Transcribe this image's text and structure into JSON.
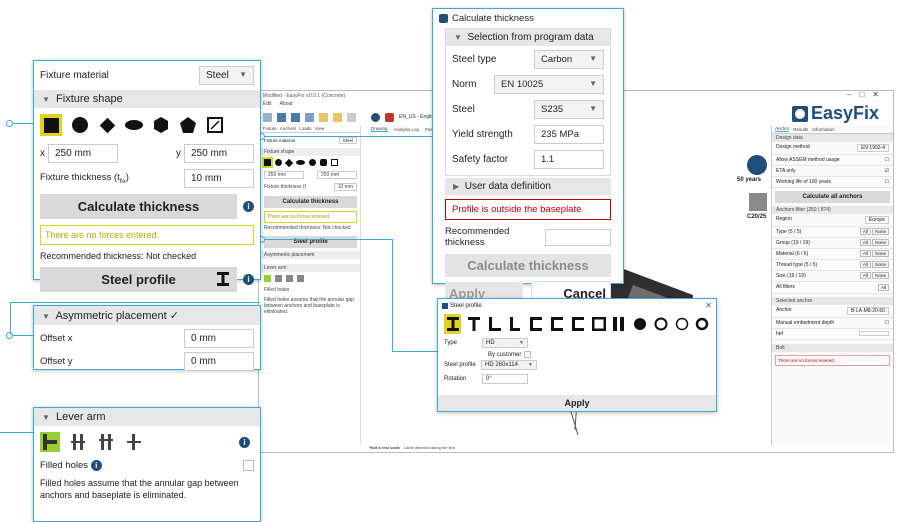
{
  "app": {
    "title": "Modified - EasyFix v.0.0.1 (Concrete)",
    "menu": [
      "Edit",
      "About"
    ],
    "logo": "EasyFix",
    "win_controls": [
      "–",
      "□",
      "✕"
    ],
    "left_tabs": [
      "Fixture",
      "Anchors",
      "Loads",
      "View"
    ],
    "center_tabs": [
      "Drawing",
      "Analysis Log",
      "Partial Log"
    ],
    "language": "EN_US - English",
    "right_tabs": [
      "Anchor",
      "Results",
      "Information"
    ],
    "right_section": "Design data",
    "design_method_label": "Design method",
    "design_method": "EN 1992-4",
    "design_options": [
      "Allow ASSEM method usage",
      "ETA only",
      "Working life of 100 years"
    ],
    "calc_all": "Calculate all anchors",
    "anchor_filter": "Anchors filter (250 / 874)",
    "region_label": "Region",
    "region": "Europe",
    "filters": [
      {
        "label": "Type (5 / 5)",
        "all": "All",
        "none": "None"
      },
      {
        "label": "Group (19 / 19)",
        "all": "All",
        "none": "None"
      },
      {
        "label": "Material (6 / 6)",
        "all": "All",
        "none": "None"
      },
      {
        "label": "Thread type (5 / 5)",
        "all": "All",
        "none": "None"
      },
      {
        "label": "Size (19 / 19)",
        "all": "All",
        "none": "None"
      }
    ],
    "all_filters": "All filters",
    "selected_anchor": "Selected anchor",
    "anchor_label": "Anchor",
    "anchor_value": "B-LA-M8-20-50",
    "manual_depth": "Manual embedment depth",
    "hef": "hef",
    "bolt": "Bolt",
    "no_forces_small": "There are no forces entered.",
    "badge_years": "50 years",
    "badge_concrete": "C20/25",
    "status": "*Not a real scale",
    "status2": "Label direction along the line"
  },
  "fixture": {
    "material_label": "Fixture material",
    "material": "Steel",
    "shape_header": "Fixture shape",
    "x_label": "x",
    "x_value": "250 mm",
    "y_label": "y",
    "y_value": "250 mm",
    "thickness_label": "Fixture thickness (t",
    "thickness_sub": "fix",
    "thickness_value": "10 mm",
    "calc_btn": "Calculate thickness",
    "no_forces": "There are no forces entered.",
    "recommended": "Recommended thickness: Not checked",
    "steel_profile_btn": "Steel profile"
  },
  "asym": {
    "header": "Asymmetric placement",
    "check": "✓",
    "offset_x_label": "Offset x",
    "offset_x": "0 mm",
    "offset_y_label": "Offset y",
    "offset_y": "0 mm"
  },
  "lever": {
    "header": "Lever arm",
    "filled_holes": "Filled holes",
    "note": "Filled holes assume that the annular gap between anchors and baseplate is eliminated."
  },
  "calc_dialog": {
    "title": "Calculate thickness",
    "section": "Selection from program data",
    "steel_type_label": "Steel type",
    "steel_type": "Carbon",
    "norm_label": "Norm",
    "norm": "EN 10025",
    "steel_label": "Steel",
    "steel": "S235",
    "yield_label": "Yield strength",
    "yield": "235 MPa",
    "safety_label": "Safety factor",
    "safety": "1.1",
    "user_def": "User data definition",
    "error": "Profile is outside the baseplate",
    "recommended_label": "Recommended thickness",
    "calc_btn": "Calculate thickness",
    "apply": "Apply",
    "cancel": "Cancel"
  },
  "profile_dialog": {
    "title": "Steel profile",
    "close": "✕",
    "type_label": "Type",
    "type": "HD",
    "by_customer": "By customer",
    "profile_label": "Steel profile",
    "profile": "HD 260x114",
    "rotation_label": "Rotation",
    "rotation": "0°",
    "apply": "Apply"
  },
  "colors": {
    "accent": "#3fa9d6",
    "brand": "#1f4e79",
    "selected": "#e1d21c",
    "error": "#c00000",
    "lever_sel": "#9acd32"
  }
}
